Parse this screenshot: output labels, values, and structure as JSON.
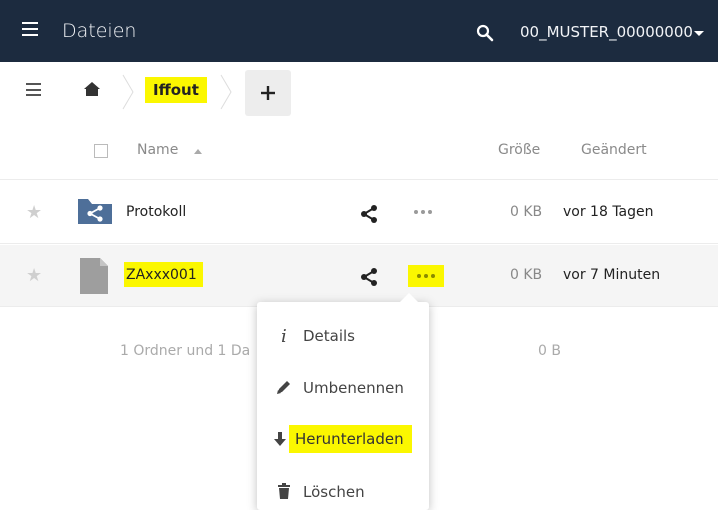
{
  "header": {
    "app_title": "Dateien",
    "user_name": "00_MUSTER_00000000"
  },
  "breadcrumb": {
    "current_folder": "Iffout",
    "add_label": "+"
  },
  "table": {
    "columns": {
      "name": "Name",
      "size": "Größe",
      "modified": "Geändert"
    },
    "rows": [
      {
        "name": "Protokoll",
        "type": "folder-shared",
        "size": "0 KB",
        "modified": "vor 18 Tagen"
      },
      {
        "name": "ZAxxx001",
        "type": "file",
        "size": "0 KB",
        "modified": "vor 7 Minuten"
      }
    ],
    "summary": "1 Ordner und 1 Da",
    "summary_size": "0 B"
  },
  "context_menu": {
    "items": [
      {
        "label": "Details",
        "icon": "info-icon"
      },
      {
        "label": "Umbenennen",
        "icon": "pencil-icon"
      },
      {
        "label": "Herunterladen",
        "icon": "download-icon"
      },
      {
        "label": "Löschen",
        "icon": "trash-icon"
      }
    ]
  },
  "colors": {
    "header_bg": "#1c2b3f",
    "highlight": "#fbf700",
    "folder_blue": "#4e6f99"
  }
}
